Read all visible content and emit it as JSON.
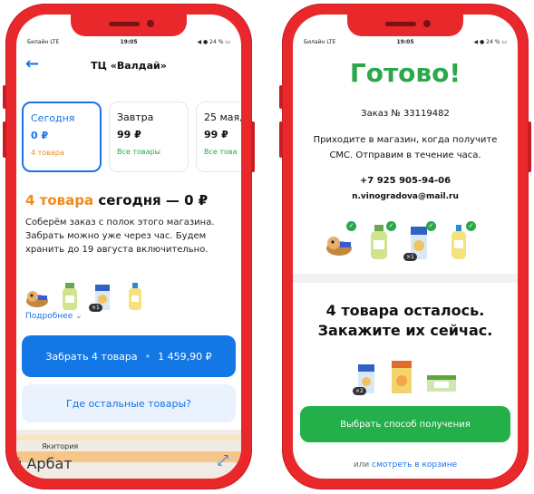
{
  "left": {
    "status": {
      "carrier": "Билайн LTE",
      "time": "19:05",
      "battery": "24 %"
    },
    "header": {
      "back": "←",
      "title": "ТЦ «Валдай»"
    },
    "days": [
      {
        "name": "Сегодня",
        "price": "0 ₽",
        "sub": "4 товара",
        "selected": true
      },
      {
        "name": "Завтра",
        "price": "99 ₽",
        "sub": "Все товары",
        "selected": false
      },
      {
        "name": "25 мая,",
        "price": "99 ₽",
        "sub": "Все това",
        "selected": false
      }
    ],
    "heading_count": "4 товара",
    "heading_rest": "сегодня — 0 ₽",
    "paragraph": "Соберём заказ с полок этого магазина. Забрать можно уже через час. Будем хранить до 19 августа включительно.",
    "thumb_badge": "×1",
    "more_link": "Подробнее ⌄",
    "pickup_button": {
      "label": "Забрать 4 товара",
      "dot": "•",
      "price": "1 459,90 ₽"
    },
    "where_button": "Где остальные товары?",
    "map": {
      "label1": "Якитория",
      "label2": "й Арбат"
    }
  },
  "right": {
    "status": {
      "carrier": "Билайн LTE",
      "time": "19:05",
      "battery": "24 %"
    },
    "title": "Готово!",
    "order": "Заказ № 33119482",
    "come": "Приходите в магазин, когда получите СМС. Отправим в течение часа.",
    "phone": "+7 925 905-94-06",
    "email": "n.vinogradova@mail.ru",
    "thumb_badge": "×1",
    "remain_line1": "4 товара осталось.",
    "remain_line2": "Закажите их сейчас.",
    "thumb_badge2": "×2",
    "choose_button": "Выбрать способ получения",
    "or_text": "или",
    "cart_link": "смотреть в корзине"
  },
  "colors": {
    "frame": "#e8282b",
    "accent_blue": "#1477e6",
    "accent_green": "#2aa84a",
    "accent_orange": "#f08a1c"
  }
}
